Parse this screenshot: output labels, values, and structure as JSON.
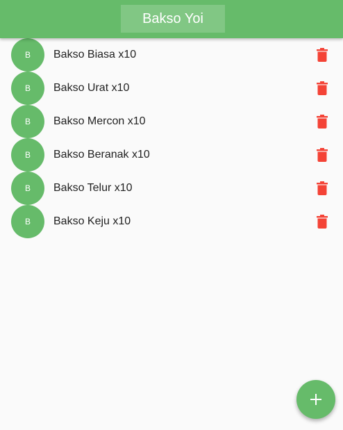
{
  "appbar": {
    "title": "Bakso Yoi"
  },
  "colors": {
    "primary": "#66bb6a",
    "title_box": "#81c784",
    "delete": "#f44336",
    "background": "#fafafa"
  },
  "items": [
    {
      "avatar": "B",
      "label": "Bakso Biasa x10",
      "icon": "trash-icon"
    },
    {
      "avatar": "B",
      "label": "Bakso Urat x10",
      "icon": "trash-icon"
    },
    {
      "avatar": "B",
      "label": "Bakso Mercon x10",
      "icon": "trash-icon"
    },
    {
      "avatar": "B",
      "label": "Bakso Beranak x10",
      "icon": "trash-icon"
    },
    {
      "avatar": "B",
      "label": "Bakso Telur x10",
      "icon": "trash-icon"
    },
    {
      "avatar": "B",
      "label": "Bakso Keju x10",
      "icon": "trash-icon"
    }
  ],
  "fab": {
    "icon": "plus-icon"
  }
}
